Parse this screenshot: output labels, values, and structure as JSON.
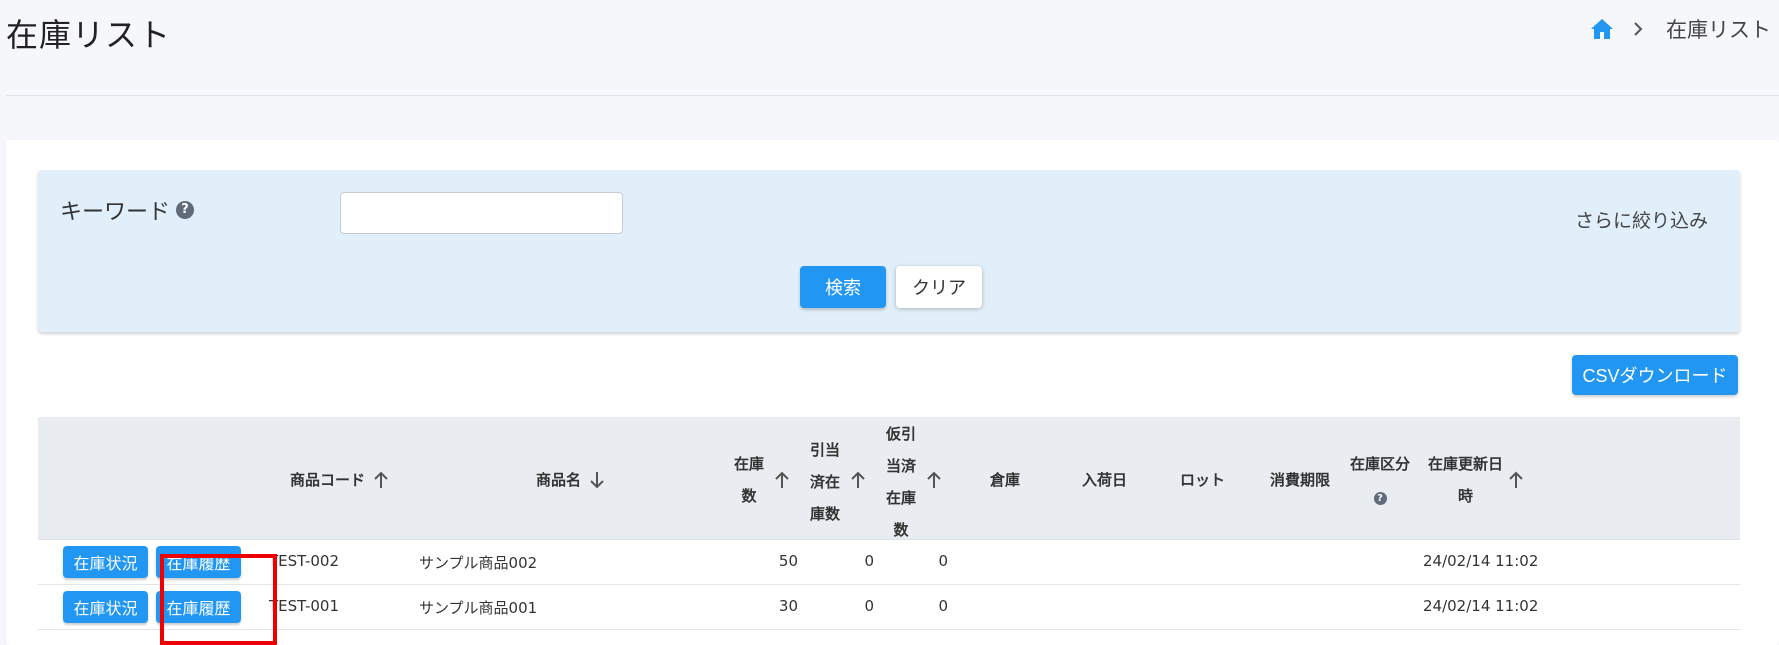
{
  "page": {
    "title": "在庫リスト"
  },
  "breadcrumb": {
    "current": "在庫リスト"
  },
  "search": {
    "keyword_label": "キーワード",
    "keyword_value": "",
    "more_filter": "さらに絞り込み",
    "search_button": "検索",
    "clear_button": "クリア"
  },
  "actions": {
    "csv_button": "CSVダウンロード"
  },
  "table": {
    "headers": {
      "code": "商品コード",
      "name": "商品名",
      "stock_l1": "在庫",
      "stock_l2": "数",
      "alloc_l1": "引当",
      "alloc_l2": "済在",
      "alloc_l3": "庫数",
      "tmp_l1": "仮引",
      "tmp_l2": "当済",
      "tmp_l3": "在庫",
      "tmp_l4": "数",
      "warehouse": "倉庫",
      "arrival": "入荷日",
      "lot": "ロット",
      "expiry": "消費期限",
      "category": "在庫区分",
      "updated_l1": "在庫更新日",
      "updated_l2": "時"
    },
    "row_buttons": {
      "status": "在庫状況",
      "history": "在庫履歴"
    },
    "rows": [
      {
        "code": "TEST-002",
        "name": "サンプル商品002",
        "stock": "50",
        "allocated": "0",
        "temp_allocated": "0",
        "updated": "24/02/14 11:02"
      },
      {
        "code": "TEST-001",
        "name": "サンプル商品001",
        "stock": "30",
        "allocated": "0",
        "temp_allocated": "0",
        "updated": "24/02/14 11:02"
      }
    ]
  },
  "colors": {
    "primary": "#2196f3",
    "panel": "#e1effa",
    "header": "#e9edf1",
    "highlight": "#e00000"
  },
  "icons": {
    "home": "home-icon",
    "separator": "chevron-right-icon",
    "help": "help-icon",
    "sort_up": "arrow-up-icon",
    "sort_down": "arrow-down-icon"
  }
}
